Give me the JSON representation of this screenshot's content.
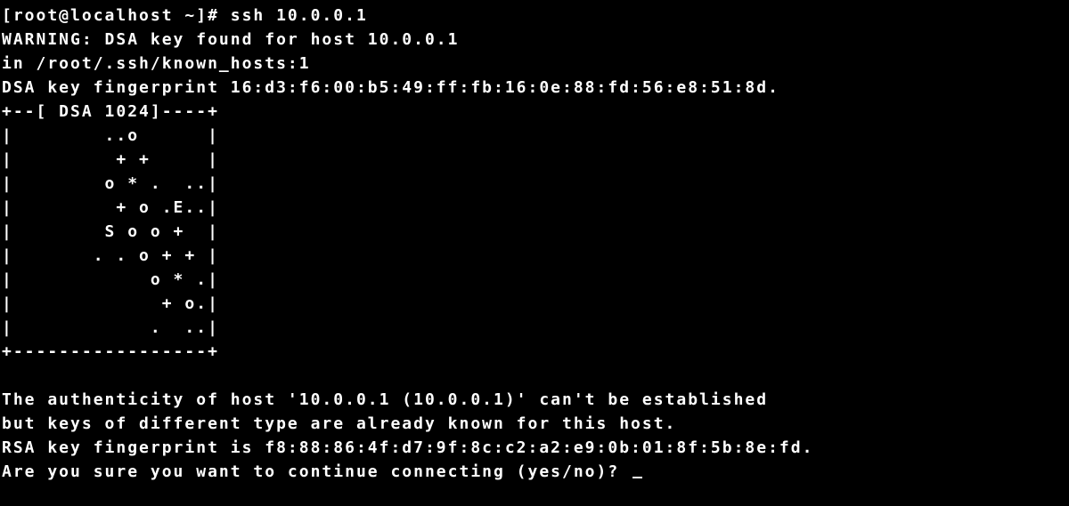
{
  "terminal": {
    "prompt_line": "[root@localhost ~]# ssh 10.0.0.1",
    "warning_line": "WARNING: DSA key found for host 10.0.0.1",
    "known_hosts_line": "in /root/.ssh/known_hosts:1",
    "dsa_fingerprint_line": "DSA key fingerprint 16:d3:f6:00:b5:49:ff:fb:16:0e:88:fd:56:e8:51:8d.",
    "randomart_top": "+--[ DSA 1024]----+",
    "randomart_row1": "|        ..o      |",
    "randomart_row2": "|         + +     |",
    "randomart_row3": "|        o * .  ..|",
    "randomart_row4": "|         + o .E..|",
    "randomart_row5": "|        S o o +  |",
    "randomart_row6": "|       . . o + + |",
    "randomart_row7": "|            o * .|",
    "randomart_row8": "|             + o.|",
    "randomart_row9": "|            .  ..|",
    "randomart_bottom": "+-----------------+",
    "blank_line": "",
    "auth_line1": "The authenticity of host '10.0.0.1 (10.0.0.1)' can't be established",
    "auth_line2": "but keys of different type are already known for this host.",
    "rsa_fingerprint_line": "RSA key fingerprint is f8:88:86:4f:d7:9f:8c:c2:a2:e9:0b:01:8f:5b:8e:fd.",
    "prompt_question": "Are you sure you want to continue connecting (yes/no)? "
  }
}
